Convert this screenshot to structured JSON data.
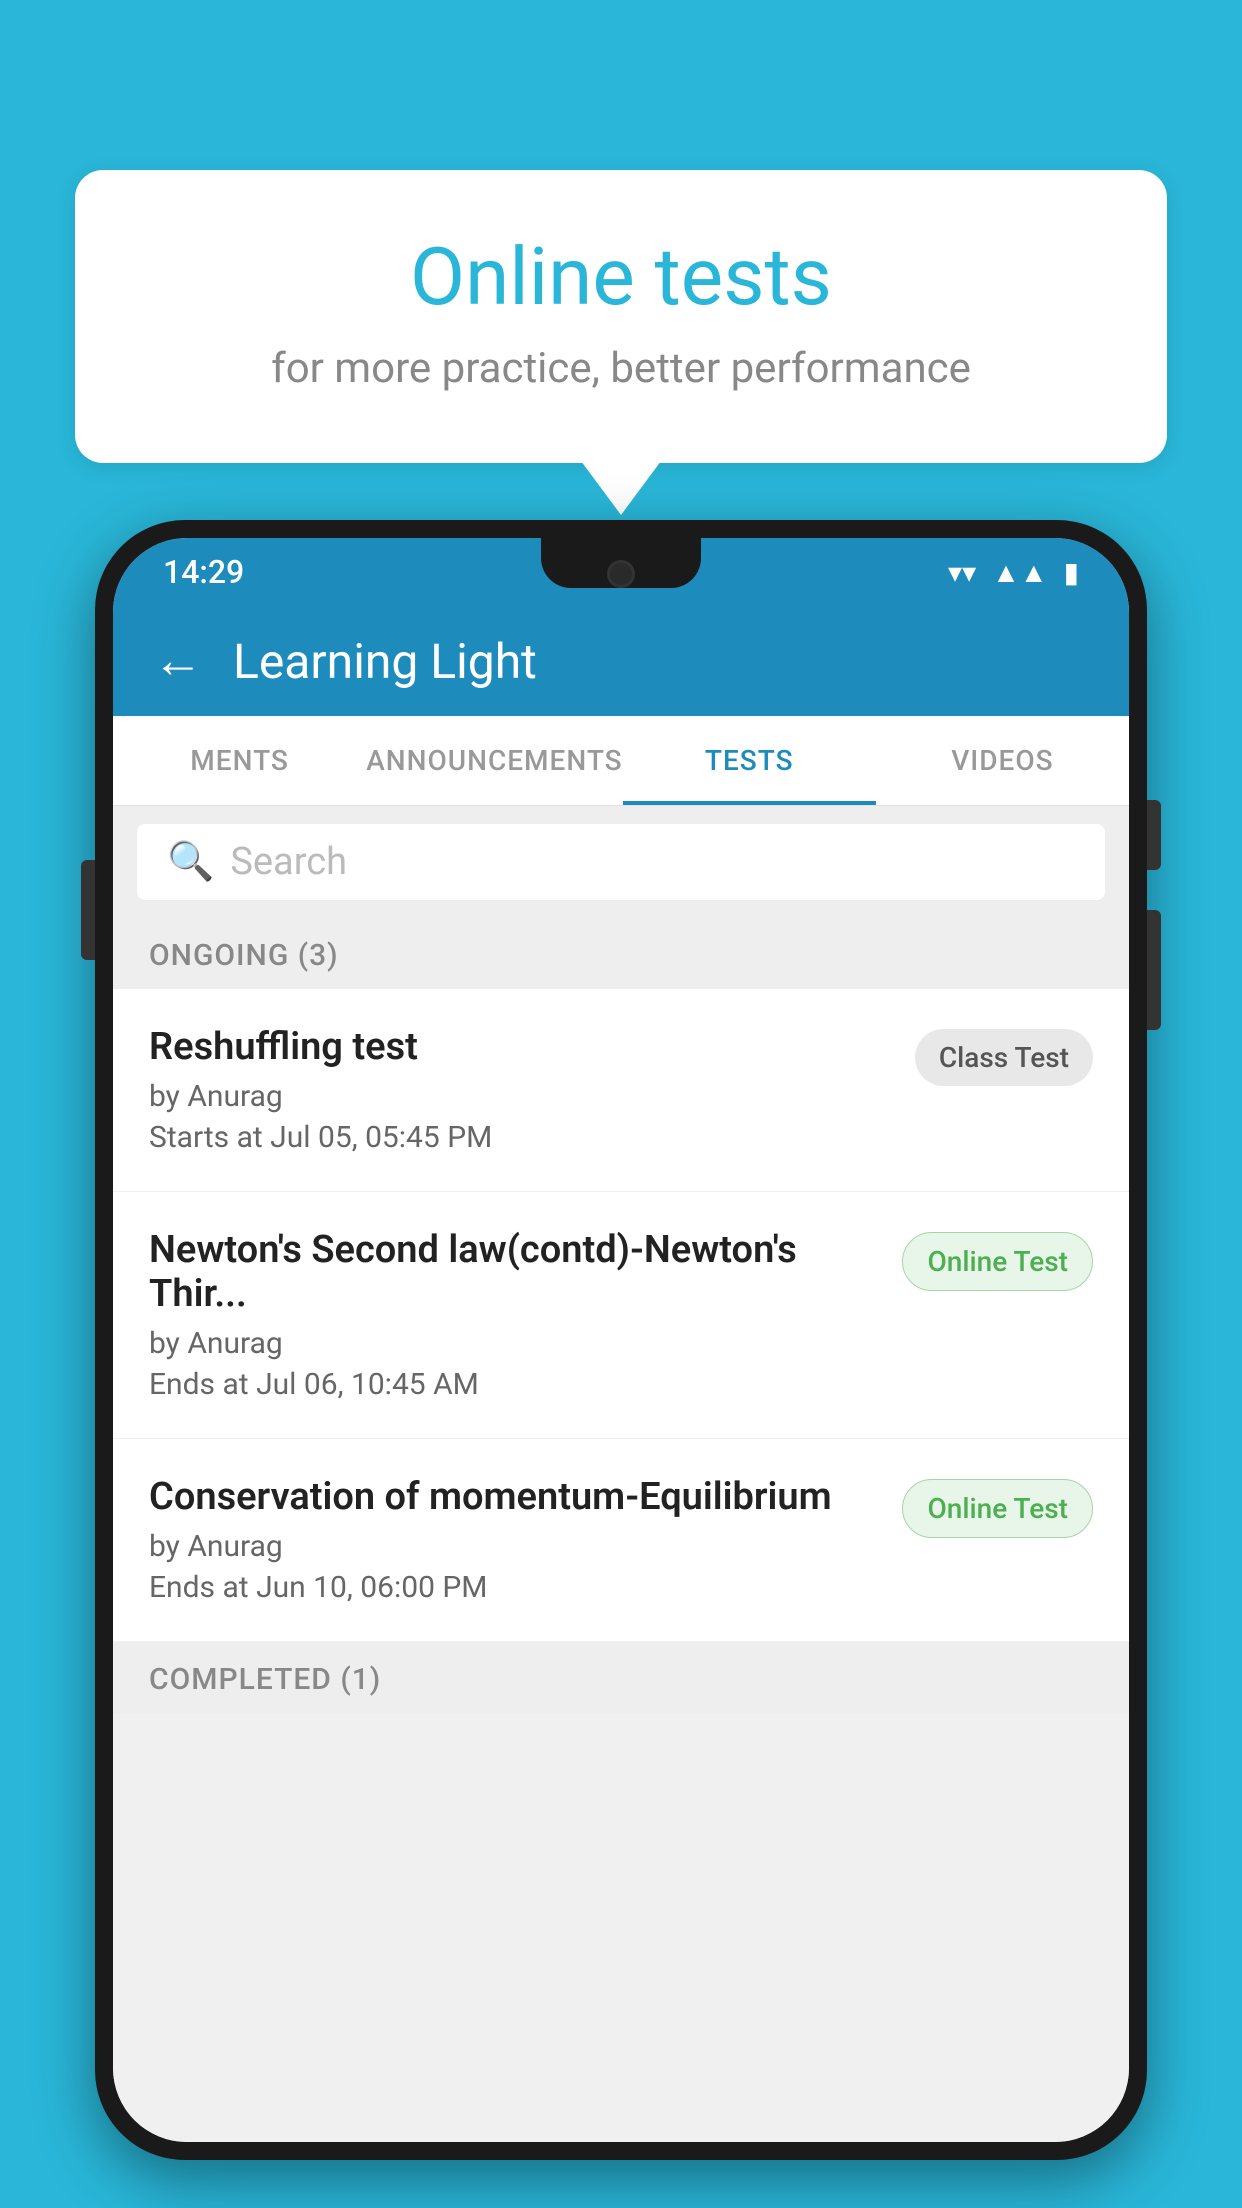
{
  "background_color": "#29b6d8",
  "bubble": {
    "title": "Online tests",
    "subtitle": "for more practice, better performance"
  },
  "status_bar": {
    "time": "14:29",
    "icons": [
      "wifi",
      "signal",
      "battery"
    ]
  },
  "header": {
    "title": "Learning Light",
    "back_label": "←"
  },
  "tabs": [
    {
      "label": "MENTS",
      "active": false
    },
    {
      "label": "ANNOUNCEMENTS",
      "active": false
    },
    {
      "label": "TESTS",
      "active": true
    },
    {
      "label": "VIDEOS",
      "active": false
    }
  ],
  "search": {
    "placeholder": "Search"
  },
  "sections": [
    {
      "title": "ONGOING (3)",
      "tests": [
        {
          "name": "Reshuffling test",
          "author": "by Anurag",
          "time_label": "Starts at",
          "time": "Jul 05, 05:45 PM",
          "badge": "Class Test",
          "badge_type": "class"
        },
        {
          "name": "Newton's Second law(contd)-Newton's Thir...",
          "author": "by Anurag",
          "time_label": "Ends at",
          "time": "Jul 06, 10:45 AM",
          "badge": "Online Test",
          "badge_type": "online"
        },
        {
          "name": "Conservation of momentum-Equilibrium",
          "author": "by Anurag",
          "time_label": "Ends at",
          "time": "Jun 10, 06:00 PM",
          "badge": "Online Test",
          "badge_type": "online"
        }
      ]
    }
  ],
  "completed_section_title": "COMPLETED (1)"
}
